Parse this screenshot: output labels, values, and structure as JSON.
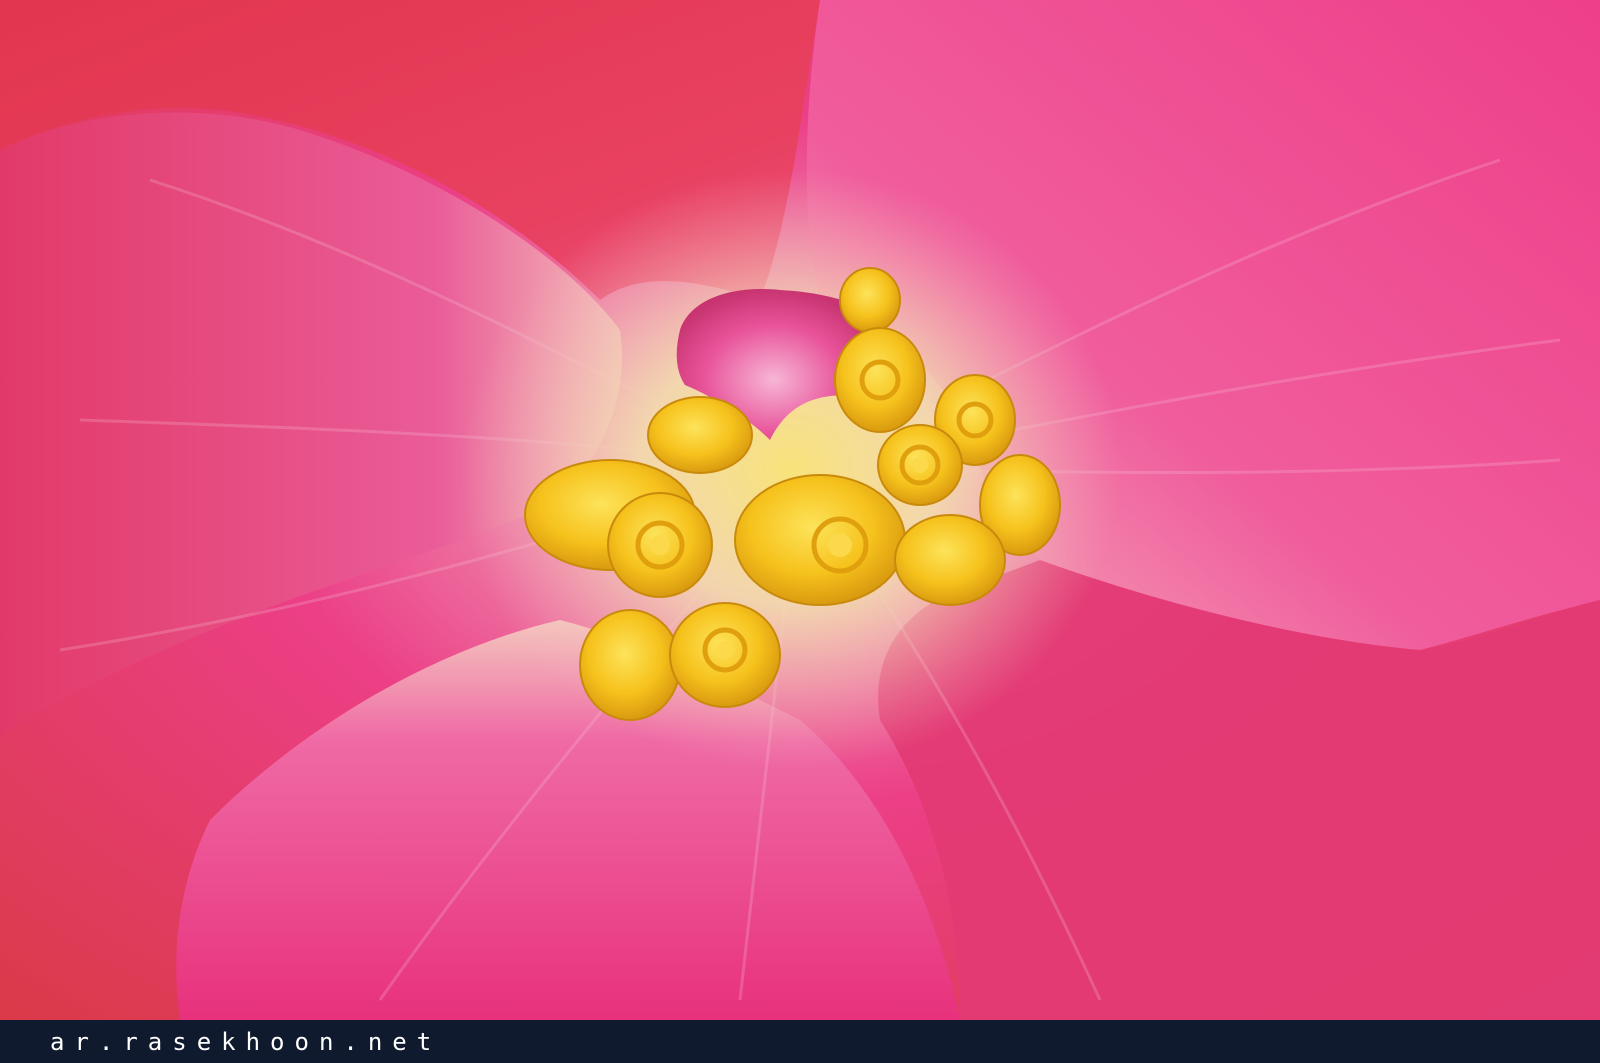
{
  "image": {
    "subject": "flower-macro",
    "colors": {
      "petal_red": "#e2354f",
      "petal_pink": "#f0408e",
      "center_cream": "#f3e0b4",
      "stamen_yellow": "#f6c21c",
      "stamen_shadow": "#d99a10",
      "pistil_pink": "#e8539a",
      "bar_background": "#0f1a2e",
      "watermark_color": "#ffffff"
    }
  },
  "watermark": {
    "text": "ar.rasekhoon.net"
  }
}
